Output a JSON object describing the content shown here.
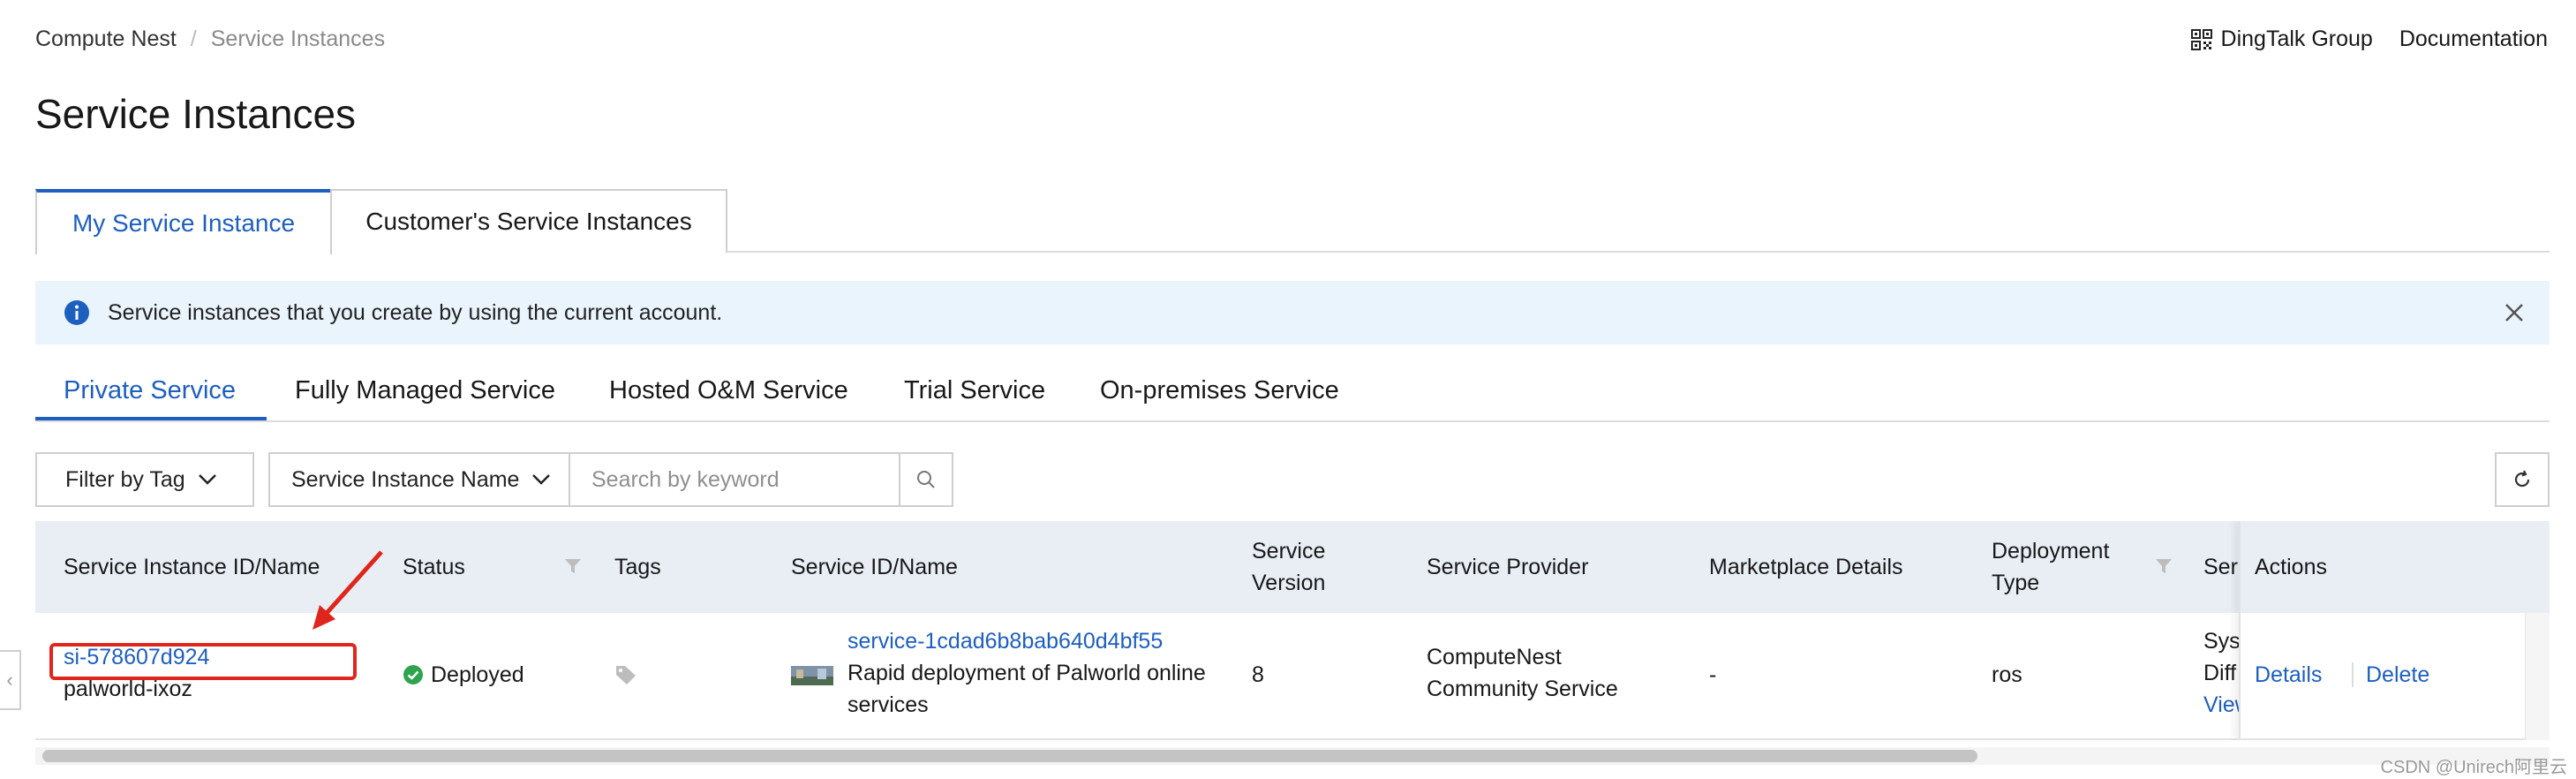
{
  "breadcrumb": {
    "root": "Compute Nest",
    "sep": "/",
    "current": "Service Instances"
  },
  "top_links": {
    "dingtalk": "DingTalk Group",
    "docs": "Documentation"
  },
  "page_title": "Service Instances",
  "tabs": [
    {
      "label": "My Service Instance",
      "active": true
    },
    {
      "label": "Customer's Service Instances",
      "active": false
    }
  ],
  "info_bar": {
    "text": "Service instances that you create by using the current account."
  },
  "subtabs": [
    {
      "label": "Private Service",
      "active": true
    },
    {
      "label": "Fully Managed Service",
      "active": false
    },
    {
      "label": "Hosted O&M Service",
      "active": false
    },
    {
      "label": "Trial Service",
      "active": false
    },
    {
      "label": "On-premises Service",
      "active": false
    }
  ],
  "filters": {
    "tag_label": "Filter by Tag",
    "field_label": "Service Instance Name",
    "search_placeholder": "Search by keyword"
  },
  "table": {
    "headers": {
      "instance": "Service Instance ID/Name",
      "status": "Status",
      "tags": "Tags",
      "service": "Service ID/Name",
      "version_1": "Service",
      "version_2": "Version",
      "provider": "Service Provider",
      "marketplace": "Marketplace Details",
      "deploy_1": "Deployment",
      "deploy_2": "Type",
      "truncated": "Ser",
      "actions": "Actions"
    },
    "rows": [
      {
        "instance_id": "si-578607d924",
        "instance_name": "palworld-ixoz",
        "status": "Deployed",
        "service_id": "service-1cdad6b8bab640d4bf55",
        "service_name_1": "Rapid deployment of Palworld online",
        "service_name_2": "services",
        "version": "8",
        "provider_1": "ComputeNest",
        "provider_2": "Community Service",
        "marketplace": "-",
        "deploy_type": "ros",
        "truncated_1": "Sys",
        "truncated_2": "Diff",
        "truncated_3": "View",
        "action_details": "Details",
        "action_delete": "Delete"
      }
    ]
  },
  "watermark": "CSDN @Unirech阿里云",
  "colors": {
    "accent": "#1d5fbf",
    "info_bg": "#eaf4fd",
    "header_bg": "#e9eef5",
    "success": "#2ea44f",
    "highlight": "#e0251c"
  }
}
